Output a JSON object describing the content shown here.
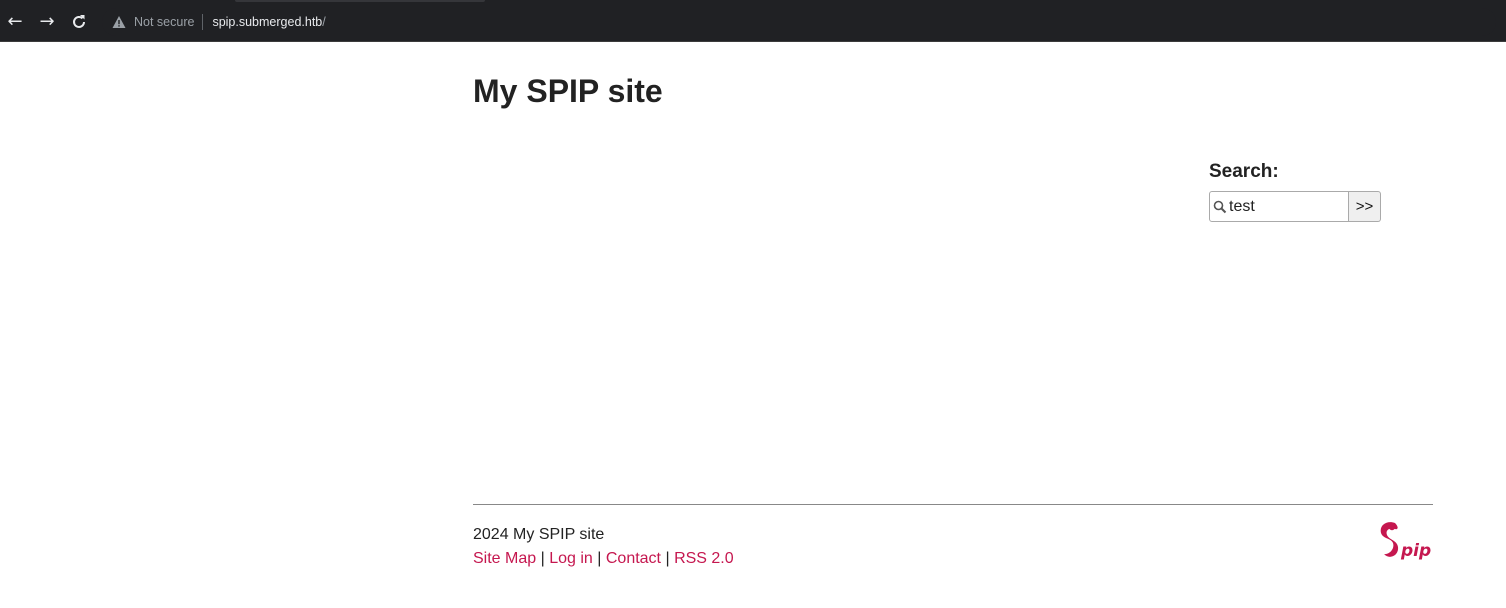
{
  "browser": {
    "security_label": "Not secure",
    "url_host": "spip.submerged.htb",
    "url_path": "/"
  },
  "site": {
    "title": "My SPIP site"
  },
  "search": {
    "label": "Search:",
    "value": "test",
    "submit_label": ">>"
  },
  "footer": {
    "copyright": "2024 My SPIP site",
    "links": [
      "Site Map",
      "Log in",
      "Contact",
      "RSS 2.0"
    ],
    "separator": "|",
    "logo_text": "Spip"
  },
  "colors": {
    "link": "#c5174f",
    "chrome_bg": "#202124"
  }
}
